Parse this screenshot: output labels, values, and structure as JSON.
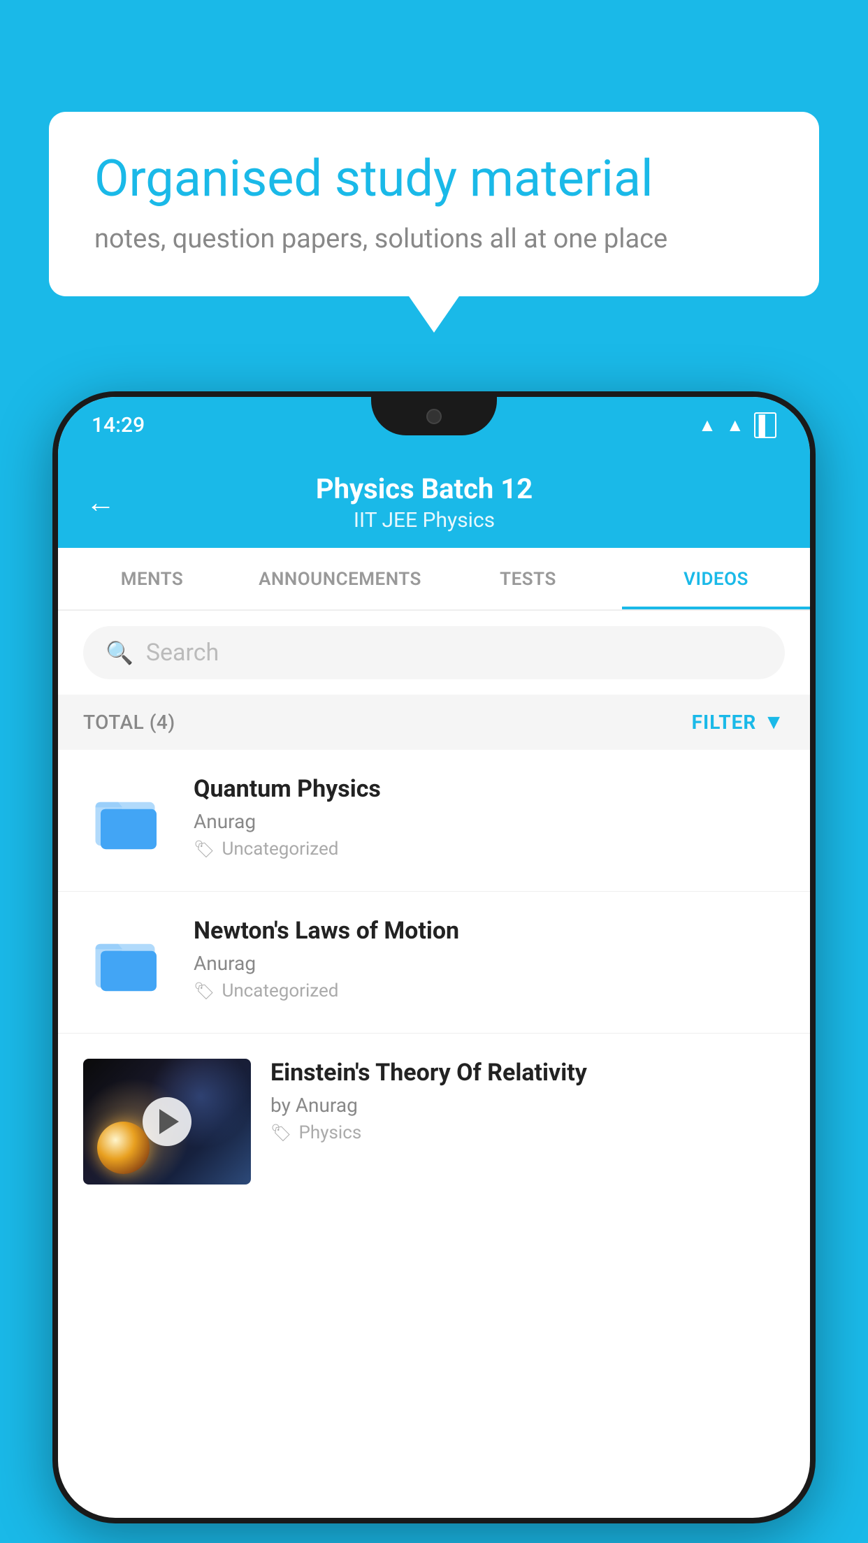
{
  "background_color": "#1ab9e8",
  "speech_bubble": {
    "title": "Organised study material",
    "subtitle": "notes, question papers, solutions all at one place"
  },
  "phone": {
    "status_bar": {
      "time": "14:29"
    },
    "app_header": {
      "title": "Physics Batch 12",
      "tags": "IIT JEE   Physics",
      "back_label": "←"
    },
    "tabs": [
      {
        "label": "MENTS",
        "active": false
      },
      {
        "label": "ANNOUNCEMENTS",
        "active": false
      },
      {
        "label": "TESTS",
        "active": false
      },
      {
        "label": "VIDEOS",
        "active": true
      }
    ],
    "search": {
      "placeholder": "Search"
    },
    "filter_row": {
      "total_label": "TOTAL (4)",
      "filter_label": "FILTER"
    },
    "videos": [
      {
        "id": 1,
        "title": "Quantum Physics",
        "author": "Anurag",
        "tag": "Uncategorized",
        "has_thumb": false
      },
      {
        "id": 2,
        "title": "Newton's Laws of Motion",
        "author": "Anurag",
        "tag": "Uncategorized",
        "has_thumb": false
      },
      {
        "id": 3,
        "title": "Einstein's Theory Of Relativity",
        "author": "by Anurag",
        "tag": "Physics",
        "has_thumb": true
      }
    ]
  }
}
